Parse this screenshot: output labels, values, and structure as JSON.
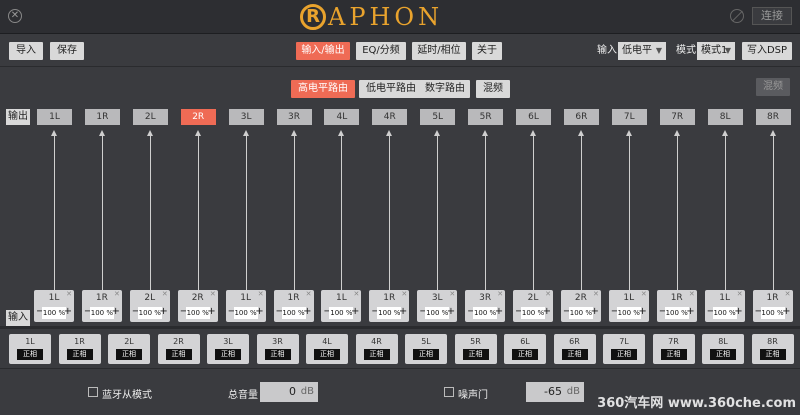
{
  "titlebar": {
    "logo_r": "R",
    "logo_text": "APHON",
    "connect_label": "连接"
  },
  "toolbar": {
    "import_label": "导入",
    "save_label": "保存",
    "tabs": [
      "输入/输出",
      "EQ/分频",
      "延时/相位",
      "关于"
    ],
    "active_tab": 0,
    "input_label": "输入",
    "input_value": "低电平",
    "mode_label": "模式",
    "mode_value": "模式1",
    "write_label": "写入DSP"
  },
  "subtabs": {
    "items": [
      "高电平路由",
      "低电平路由",
      "数字路由",
      "混频"
    ],
    "active": 0,
    "right_label": "混频"
  },
  "output": {
    "label": "输出",
    "channels": [
      "1L",
      "1R",
      "2L",
      "2R",
      "3L",
      "3R",
      "4L",
      "4R",
      "5L",
      "5R",
      "6L",
      "6R",
      "7L",
      "7R",
      "8L",
      "8R"
    ],
    "active": 3
  },
  "input": {
    "label": "输入",
    "cards": [
      {
        "name": "1L",
        "value": "100 %"
      },
      {
        "name": "1R",
        "value": "100 %"
      },
      {
        "name": "2L",
        "value": "100 %"
      },
      {
        "name": "2R",
        "value": "100 %"
      },
      {
        "name": "1L",
        "value": "100 %"
      },
      {
        "name": "1R",
        "value": "100 %"
      },
      {
        "name": "1L",
        "value": "100 %"
      },
      {
        "name": "1R",
        "value": "100 %"
      },
      {
        "name": "3L",
        "value": "100 %"
      },
      {
        "name": "3R",
        "value": "100 %"
      },
      {
        "name": "2L",
        "value": "100 %"
      },
      {
        "name": "2R",
        "value": "100 %"
      },
      {
        "name": "1L",
        "value": "100 %"
      },
      {
        "name": "1R",
        "value": "100 %"
      },
      {
        "name": "1L",
        "value": "100 %"
      },
      {
        "name": "1R",
        "value": "100 %"
      }
    ]
  },
  "bottom_channels": {
    "phase_label": "正相",
    "names": [
      "1L",
      "1R",
      "2L",
      "2R",
      "3L",
      "3R",
      "4L",
      "4R",
      "5L",
      "5R",
      "6L",
      "6R",
      "7L",
      "7R",
      "8L",
      "8R"
    ]
  },
  "footer": {
    "bluetooth_label": "蓝牙从模式",
    "master_volume_label": "总音量",
    "master_volume_value": "0",
    "master_volume_unit": "dB",
    "noise_gate_label": "噪声门",
    "noise_gate_value": "-65",
    "noise_gate_unit": "dB",
    "watermark": "360汽车网 www.360che.com"
  }
}
